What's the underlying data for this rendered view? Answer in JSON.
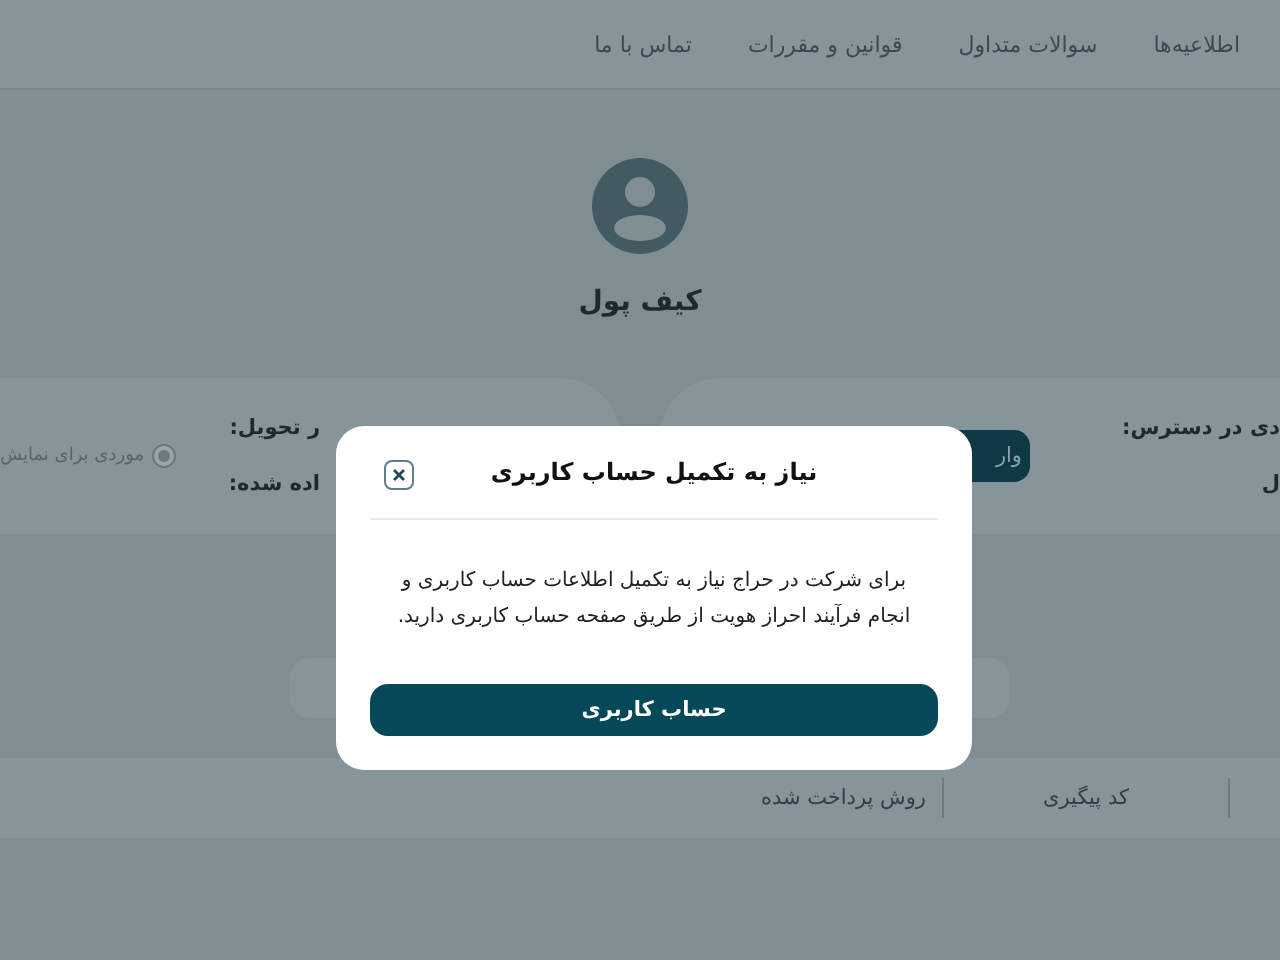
{
  "nav": {
    "links": [
      "اطلاعیه‌ها",
      "سوالات متداول",
      "قوانین و مقررات",
      "تماس با ما"
    ]
  },
  "profile": {
    "title": "کیف پول"
  },
  "balance_card": {
    "lines": [
      "دی در دسترس:",
      "ل"
    ],
    "button": "وار"
  },
  "delivery_card": {
    "lines": [
      "ر تحویل:",
      "اده شده:"
    ],
    "radio": {
      "label": "موردی برای نمایش",
      "selected": true
    }
  },
  "table": {
    "columns": [
      "کد پیگیری",
      "روش پرداخت شده"
    ]
  },
  "modal": {
    "title": "نیاز به تکمیل حساب کاربری",
    "message": "برای شرکت در حراج نیاز به تکمیل اطلاعات حساب کاربری و انجام فرآیند احراز هویت از طریق صفحه حساب کاربری دارید.",
    "button": "حساب کاربری"
  }
}
